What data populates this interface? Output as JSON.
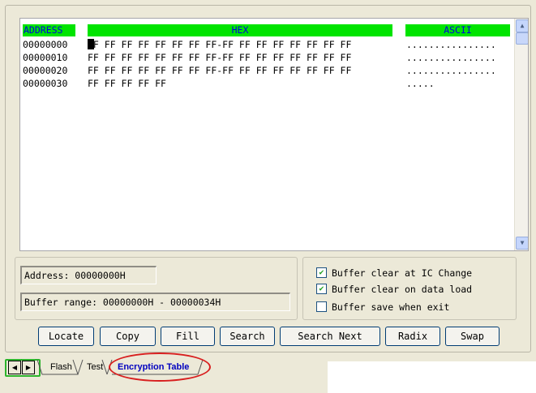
{
  "hex_view": {
    "headers": {
      "address": "ADDRESS",
      "hex": "HEX",
      "ascii": "ASCII"
    },
    "rows": [
      {
        "address": "00000000",
        "hex": "FF FF FF FF FF FF FF FF-FF FF FF FF FF FF FF FF",
        "ascii": "................"
      },
      {
        "address": "00000010",
        "hex": "FF FF FF FF FF FF FF FF-FF FF FF FF FF FF FF FF",
        "ascii": "................"
      },
      {
        "address": "00000020",
        "hex": "FF FF FF FF FF FF FF FF-FF FF FF FF FF FF FF FF",
        "ascii": "................"
      },
      {
        "address": "00000030",
        "hex": "FF FF FF FF FF",
        "ascii": "....."
      }
    ]
  },
  "info": {
    "address": "Address: 00000000H",
    "buffer_range": "Buffer range: 00000000H - 00000034H"
  },
  "options": [
    {
      "label": "Buffer clear at IC Change",
      "checked": true
    },
    {
      "label": "Buffer clear on data load",
      "checked": true
    },
    {
      "label": "Buffer save when exit",
      "checked": false
    }
  ],
  "buttons": [
    "Locate",
    "Copy",
    "Fill",
    "Search",
    "Search Next",
    "Radix",
    "Swap"
  ],
  "tabs": [
    "Flash",
    "Test",
    "Encryption Table"
  ],
  "selected_tab": "Encryption Table",
  "colors": {
    "header_bg": "#00e400",
    "header_text": "#0000e0",
    "annotation": "#d81f1f"
  }
}
